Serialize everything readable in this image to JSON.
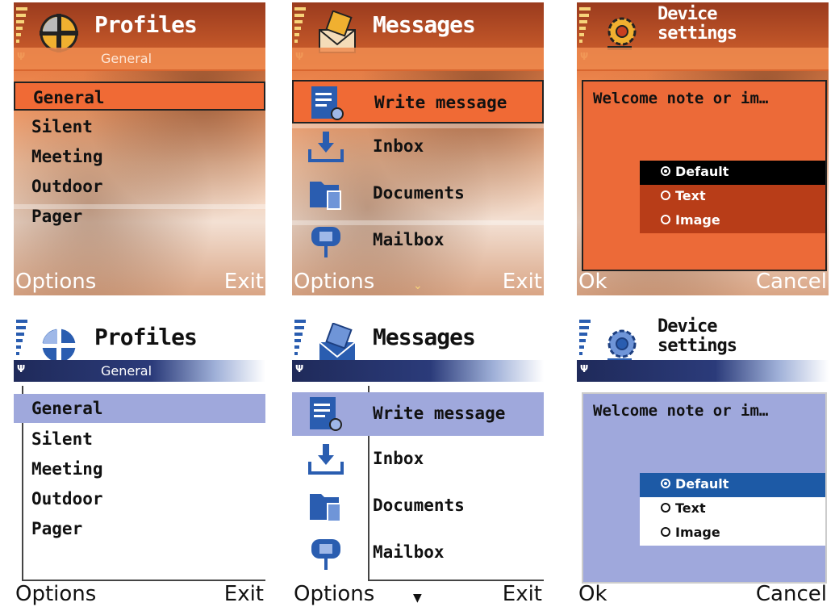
{
  "screens": {
    "s1": {
      "theme": "orange",
      "title": "Profiles",
      "subtitle": "General",
      "items": [
        "General",
        "Silent",
        "Meeting",
        "Outdoor",
        "Pager"
      ],
      "selected": 0,
      "left": "Options",
      "right": "Exit"
    },
    "s2": {
      "theme": "orange",
      "title": "Messages",
      "items": [
        "Write message",
        "Inbox",
        "Documents",
        "Mailbox"
      ],
      "selected": 0,
      "left": "Options",
      "right": "Exit"
    },
    "s3": {
      "theme": "orange",
      "title1": "Device",
      "title2": "settings",
      "dialog_title": "Welcome note or im…",
      "options": [
        "Default",
        "Text",
        "Image"
      ],
      "selected": 0,
      "left": "Ok",
      "right": "Cancel"
    },
    "s4": {
      "theme": "blue",
      "title": "Profiles",
      "subtitle": "General",
      "items": [
        "General",
        "Silent",
        "Meeting",
        "Outdoor",
        "Pager"
      ],
      "selected": 0,
      "left": "Options",
      "right": "Exit"
    },
    "s5": {
      "theme": "blue",
      "title": "Messages",
      "items": [
        "Write message",
        "Inbox",
        "Documents",
        "Mailbox"
      ],
      "selected": 0,
      "left": "Options",
      "right": "Exit"
    },
    "s6": {
      "theme": "blue",
      "title1": "Device",
      "title2": "settings",
      "dialog_title": "Welcome note or im…",
      "options": [
        "Default",
        "Text",
        "Image"
      ],
      "selected": 0,
      "left": "Ok",
      "right": "Cancel"
    }
  },
  "icons": {
    "signal": "signal-bars-icon",
    "profiles": "profiles-icon",
    "messages": "messages-icon",
    "settings": "gear-icon",
    "write": "write-message-icon",
    "inbox": "inbox-icon",
    "documents": "documents-icon",
    "mailbox": "mailbox-icon"
  },
  "colors": {
    "orange_accent": "#f06a35",
    "blue_accent": "#1d5aa6",
    "blue_highlight": "#9fa8dc"
  }
}
